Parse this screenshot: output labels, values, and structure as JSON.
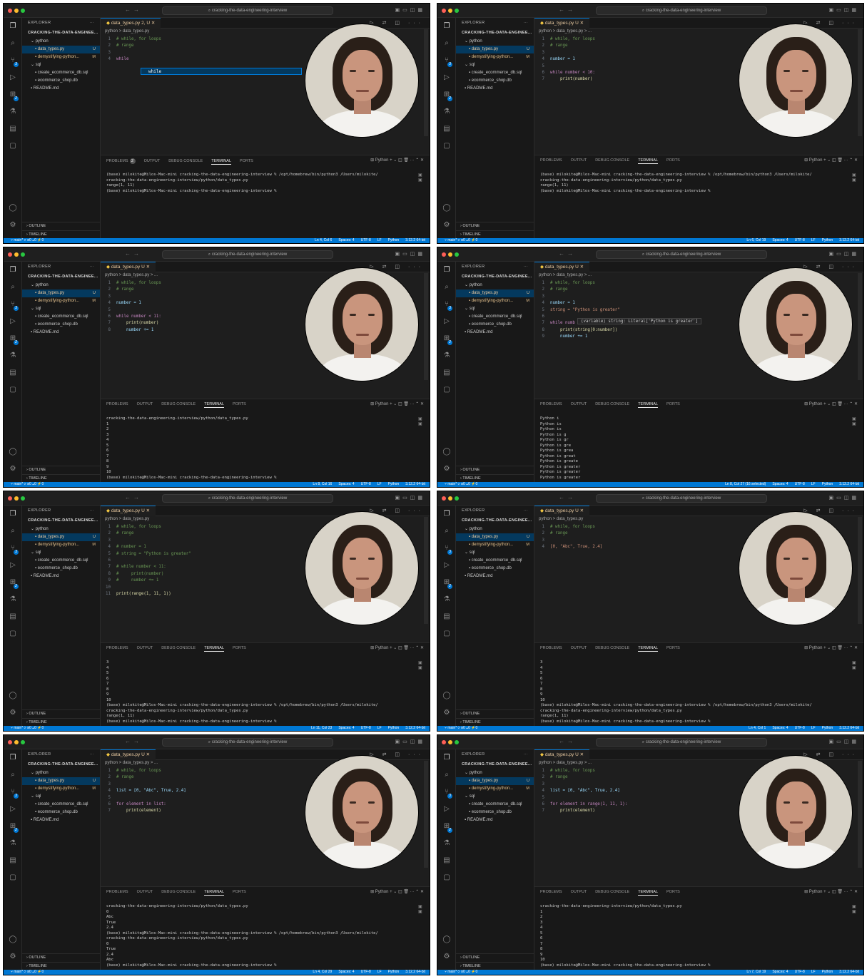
{
  "app": {
    "search_text": "cracking-the-data-engineering-interview",
    "explorer_title": "EXPLORER",
    "project": "CRACKING-THE-DATA-ENGINEE...",
    "files": [
      {
        "label": "python",
        "status": "",
        "indent": 1
      },
      {
        "label": "data_types.py",
        "status": "U",
        "indent": 2
      },
      {
        "label": "demystifying-python...",
        "status": "M",
        "indent": 2
      },
      {
        "label": "sql",
        "status": "",
        "indent": 1
      },
      {
        "label": "create_ecommerce_db.sql",
        "status": "",
        "indent": 2
      },
      {
        "label": "ecommerce_shop.db",
        "status": "",
        "indent": 2
      },
      {
        "label": "README.md",
        "status": "",
        "indent": 1
      }
    ],
    "outline_label": "OUTLINE",
    "timeline_label": "TIMELINE",
    "panel_tabs": [
      "PROBLEMS",
      "OUTPUT",
      "DEBUG CONSOLE",
      "TERMINAL",
      "PORTS"
    ],
    "terminal_shell": "Python",
    "status_branch": "main*",
    "status_items": [
      "Spaces: 4",
      "UTF-8",
      "LF",
      "Python",
      "3.12.2 64-bit"
    ],
    "colors": {
      "accent": "#0078d4",
      "editor_bg": "#1e1e1e",
      "sidebar_bg": "#181818"
    }
  },
  "frames": [
    {
      "tab": "data_types.py 2, U",
      "breadcrumb": "python > data_types.py",
      "code": [
        [
          "cmt",
          "# while, for loops"
        ],
        [
          "cmt",
          "# range"
        ],
        [
          "",
          ""
        ],
        [
          "kw",
          "while"
        ]
      ],
      "suggestion": "while",
      "hover": "",
      "problems_count": "2",
      "terminal": [
        "(base) milokite@Milos-Mac-mini cracking-the-data-engineering-interview % /opt/homebrew/bin/python3 /Users/milokite/",
        "cracking-the-data-engineering-interview/python/data_types.py",
        "range(1, 11)",
        "(base) milokite@Milos-Mac-mini cracking-the-data-engineering-interview % "
      ],
      "cursor": "Ln 4, Col 6"
    },
    {
      "tab": "data_types.py U",
      "breadcrumb": "python > data_types.py > ...",
      "code": [
        [
          "cmt",
          "# while, for loops"
        ],
        [
          "cmt",
          "# range"
        ],
        [
          "",
          ""
        ],
        [
          "var",
          "number = 1"
        ],
        [
          "",
          ""
        ],
        [
          "kw",
          "while number < 10:"
        ],
        [
          "fn",
          "    print(number)"
        ]
      ],
      "suggestion": "",
      "hover": "",
      "problems_count": "",
      "terminal": [
        "(base) milokite@Milos-Mac-mini cracking-the-data-engineering-interview % /opt/homebrew/bin/python3 /Users/milokite/",
        "cracking-the-data-engineering-interview/python/data_types.py",
        "range(1, 11)",
        "(base) milokite@Milos-Mac-mini cracking-the-data-engineering-interview % "
      ],
      "cursor": "Ln 6, Col 19"
    },
    {
      "tab": "data_types.py U",
      "breadcrumb": "python > data_types.py > ...",
      "code": [
        [
          "cmt",
          "# while, for loops"
        ],
        [
          "cmt",
          "# range"
        ],
        [
          "",
          ""
        ],
        [
          "var",
          "number = 1"
        ],
        [
          "",
          ""
        ],
        [
          "kw",
          "while number < 11:"
        ],
        [
          "fn",
          "    print(number)"
        ],
        [
          "var",
          "    number += 1"
        ]
      ],
      "suggestion": "",
      "hover": "",
      "problems_count": "",
      "terminal": [
        "cracking-the-data-engineering-interview/python/data_types.py",
        "1",
        "2",
        "3",
        "4",
        "5",
        "6",
        "7",
        "8",
        "9",
        "10",
        "(base) milokite@Milos-Mac-mini cracking-the-data-engineering-interview % "
      ],
      "cursor": "Ln 8, Col 16"
    },
    {
      "tab": "data_types.py U",
      "breadcrumb": "python > data_types.py > ...",
      "code": [
        [
          "cmt",
          "# while, for loops"
        ],
        [
          "cmt",
          "# range"
        ],
        [
          "",
          ""
        ],
        [
          "var",
          "number = 1"
        ],
        [
          "str",
          "string = \"Python is greater\""
        ],
        [
          "",
          ""
        ],
        [
          "kw",
          "while numb"
        ],
        [
          "fn",
          "    print(string[0:number])"
        ],
        [
          "var",
          "    number += 1"
        ]
      ],
      "suggestion": "",
      "hover": "(variable) string: Literal['Python is greater']",
      "problems_count": "",
      "terminal": [
        "Python i",
        "Python is",
        "Python is ",
        "Python is g",
        "Python is gr",
        "Python is gre",
        "Python is grea",
        "Python is great",
        "Python is greate",
        "Python is greater",
        "Python is greater",
        "Python is greater"
      ],
      "cursor": "Ln 8, Col 27 (16 selected)"
    },
    {
      "tab": "data_types.py U",
      "breadcrumb": "python > data_types.py",
      "code": [
        [
          "cmt",
          "# while, for loops"
        ],
        [
          "cmt",
          "# range"
        ],
        [
          "",
          ""
        ],
        [
          "cmt",
          "# number = 1"
        ],
        [
          "cmt",
          "# string = \"Python is greater\""
        ],
        [
          "",
          ""
        ],
        [
          "cmt",
          "# while number < 11:"
        ],
        [
          "cmt",
          "#     print(number)"
        ],
        [
          "cmt",
          "#     number += 1"
        ],
        [
          "",
          ""
        ],
        [
          "fn",
          "print(range(1, 11, 1))"
        ]
      ],
      "suggestion": "",
      "hover": "",
      "problems_count": "",
      "terminal": [
        "3",
        "4",
        "5",
        "6",
        "7",
        "8",
        "9",
        "10",
        "(base) milokite@Milos-Mac-mini cracking-the-data-engineering-interview % /opt/homebrew/bin/python3 /Users/milokite/",
        "cracking-the-data-engineering-interview/python/data_types.py",
        "range(1, 11)",
        "(base) milokite@Milos-Mac-mini cracking-the-data-engineering-interview % "
      ],
      "cursor": "Ln 11, Col 23"
    },
    {
      "tab": "data_types.py U",
      "breadcrumb": "python > data_types.py",
      "code": [
        [
          "cmt",
          "# while, for loops"
        ],
        [
          "cmt",
          "# range"
        ],
        [
          "",
          ""
        ],
        [
          "str",
          "[0, \"Abc\", True, 2.4]"
        ]
      ],
      "suggestion": "",
      "hover": "",
      "problems_count": "",
      "terminal": [
        "3",
        "4",
        "5",
        "6",
        "7",
        "8",
        "9",
        "10",
        "(base) milokite@Milos-Mac-mini cracking-the-data-engineering-interview % /opt/homebrew/bin/python3 /Users/milokite/",
        "cracking-the-data-engineering-interview/python/data_types.py",
        "range(1, 11)",
        "(base) milokite@Milos-Mac-mini cracking-the-data-engineering-interview % "
      ],
      "cursor": "Ln 4, Col 1"
    },
    {
      "tab": "data_types.py U",
      "breadcrumb": "python > data_types.py > ...",
      "code": [
        [
          "cmt",
          "# while, for loops"
        ],
        [
          "cmt",
          "# range"
        ],
        [
          "",
          ""
        ],
        [
          "var",
          "list = [0, \"Abc\", True, 2.4]"
        ],
        [
          "",
          ""
        ],
        [
          "kw",
          "for element in list:"
        ],
        [
          "fn",
          "    print(element)"
        ]
      ],
      "suggestion": "",
      "hover": "",
      "problems_count": "",
      "terminal": [
        "cracking-the-data-engineering-interview/python/data_types.py",
        "0",
        "Abc",
        "True",
        "2.4",
        "(base) milokite@Milos-Mac-mini cracking-the-data-engineering-interview % /opt/homebrew/bin/python3 /Users/milokite/",
        "cracking-the-data-engineering-interview/python/data_types.py",
        "0",
        "True",
        "2.4",
        "Abc",
        "(base) milokite@Milos-Mac-mini cracking-the-data-engineering-interview % "
      ],
      "cursor": "Ln 4, Col 29"
    },
    {
      "tab": "data_types.py U",
      "breadcrumb": "python > data_types.py > ...",
      "code": [
        [
          "cmt",
          "# while, for loops"
        ],
        [
          "cmt",
          "# range"
        ],
        [
          "",
          ""
        ],
        [
          "var",
          "list = [0, \"Abc\", True, 2.4]"
        ],
        [
          "",
          ""
        ],
        [
          "kw",
          "for element in range(1, 11, 1):"
        ],
        [
          "fn",
          "    print(element)"
        ]
      ],
      "suggestion": "",
      "hover": "",
      "problems_count": "",
      "terminal": [
        "cracking-the-data-engineering-interview/python/data_types.py",
        "1",
        "2",
        "3",
        "4",
        "5",
        "6",
        "7",
        "8",
        "9",
        "10",
        "(base) milokite@Milos-Mac-mini cracking-the-data-engineering-interview % "
      ],
      "cursor": "Ln 7, Col 19"
    }
  ]
}
